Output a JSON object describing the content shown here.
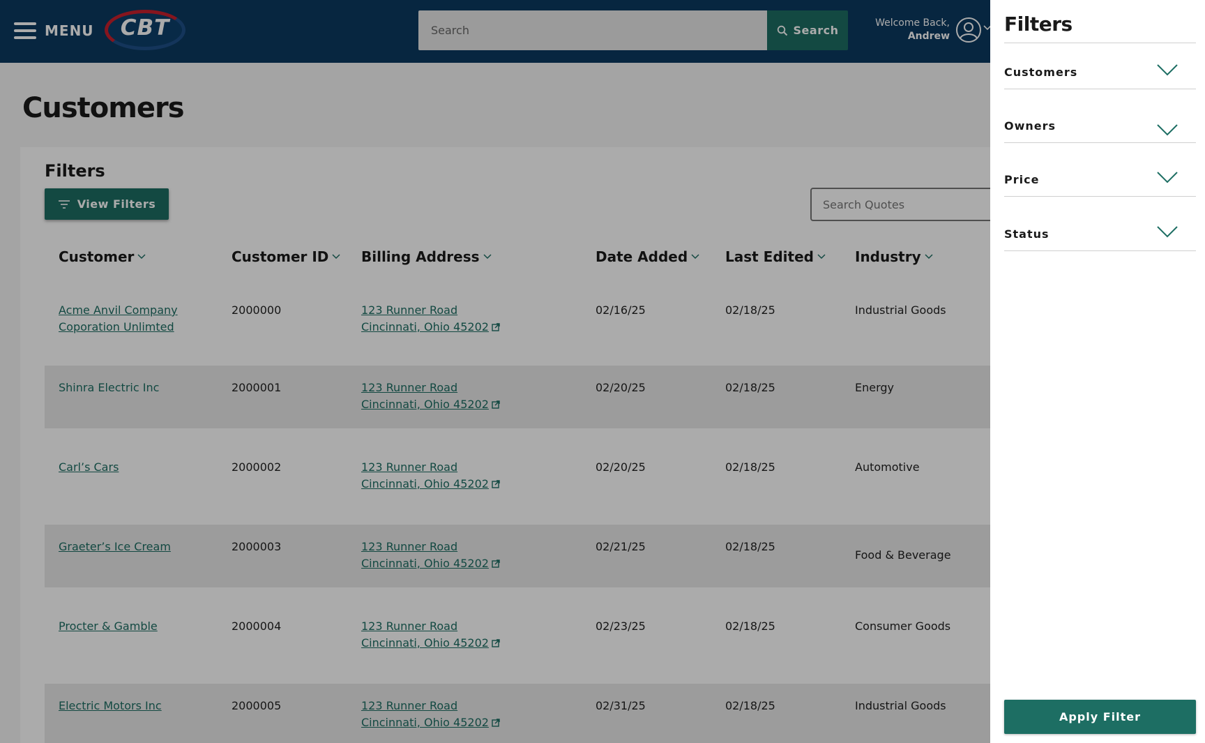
{
  "header": {
    "menu_label": "MENU",
    "logo_text": "CBT",
    "search_placeholder": "Search",
    "search_button": "Search",
    "welcome_line": "Welcome Back,",
    "user_name": "Andrew"
  },
  "page": {
    "title": "Customers",
    "filters_heading": "Filters",
    "view_filters_label": "View Filters",
    "search_quotes_placeholder": "Search Quotes"
  },
  "table": {
    "columns": [
      "Customer",
      "Customer ID",
      "Billing Address",
      "Date Added",
      "Last Edited",
      "Industry"
    ],
    "rows": [
      {
        "customer_line1": "Acme Anvil Company",
        "customer_line2": "Coporation Unlimted",
        "id": "2000000",
        "address_line1": "123 Runner Road",
        "address_line2": "Cincinnati, Ohio 45202",
        "date_added": "02/16/25",
        "last_edited": "02/18/25",
        "industry": "Industrial Goods"
      },
      {
        "customer_line1": "Shinra Electric Inc",
        "customer_line2": "",
        "id": "2000001",
        "address_line1": "123 Runner Road",
        "address_line2": "Cincinnati, Ohio 45202",
        "date_added": "02/20/25",
        "last_edited": "02/18/25",
        "industry": "Energy"
      },
      {
        "customer_line1": "Carl’s Cars",
        "customer_line2": "",
        "id": "2000002",
        "address_line1": "123 Runner Road",
        "address_line2": "Cincinnati, Ohio 45202",
        "date_added": "02/20/25",
        "last_edited": "02/18/25",
        "industry": "Automotive"
      },
      {
        "customer_line1": "Graeter’s Ice Cream",
        "customer_line2": "",
        "id": "2000003",
        "address_line1": "123 Runner Road",
        "address_line2": "Cincinnati, Ohio 45202",
        "date_added": "02/21/25",
        "last_edited": "02/18/25",
        "industry": "Food & Beverage"
      },
      {
        "customer_line1": "Procter & Gamble",
        "customer_line2": "",
        "id": "2000004",
        "address_line1": "123 Runner Road",
        "address_line2": "Cincinnati, Ohio 45202",
        "date_added": "02/23/25",
        "last_edited": "02/18/25",
        "industry": "Consumer Goods"
      },
      {
        "customer_line1": "Electric Motors Inc",
        "customer_line2": "",
        "id": "2000005",
        "address_line1": "123 Runner Road",
        "address_line2": "Cincinnati, Ohio 45202",
        "date_added": "02/31/25",
        "last_edited": "02/18/25",
        "industry": "Industrial Goods"
      }
    ]
  },
  "drawer": {
    "title": "Filters",
    "sections": [
      "Customers",
      "Owners",
      "Price",
      "Status"
    ],
    "apply_label": "Apply Filter"
  },
  "icons": {
    "menu": "hamburger-icon",
    "search": "search-icon",
    "user": "user-circle-icon",
    "filter": "filter-lines-icon",
    "external": "external-link-icon",
    "chevron": "chevron-down-icon"
  },
  "colors": {
    "header_bg": "#0b3a60",
    "accent_green": "#1d6e63",
    "logo_red": "#c8202e"
  }
}
